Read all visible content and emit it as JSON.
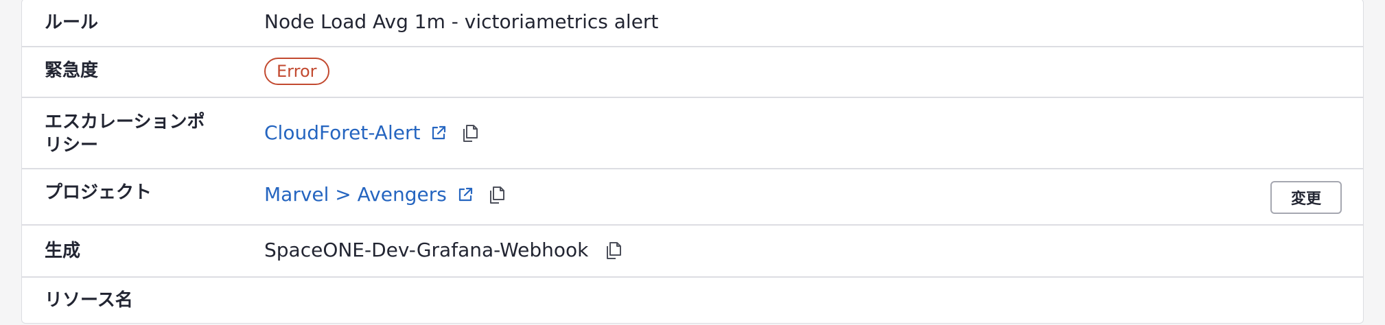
{
  "rows": {
    "rule": {
      "label": "ルール",
      "value": "Node Load Avg 1m - victoriametrics alert"
    },
    "urgency": {
      "label": "緊急度",
      "badge": "Error",
      "badge_color": "#c2492f"
    },
    "escalation": {
      "label_line1": "エスカレーションポ",
      "label_line2": "リシー",
      "link": "CloudForet-Alert"
    },
    "project": {
      "label": "プロジェクト",
      "link": "Marvel > Avengers",
      "button": "変更"
    },
    "created": {
      "label": "生成",
      "value": "SpaceONE-Dev-Grafana-Webhook"
    },
    "resource": {
      "label": "リソース名",
      "value": ""
    }
  },
  "colors": {
    "link": "#2565c0",
    "text": "#222532",
    "border": "#dcdde2"
  },
  "icons": {
    "external": "external-link-icon",
    "copy": "copy-icon"
  }
}
